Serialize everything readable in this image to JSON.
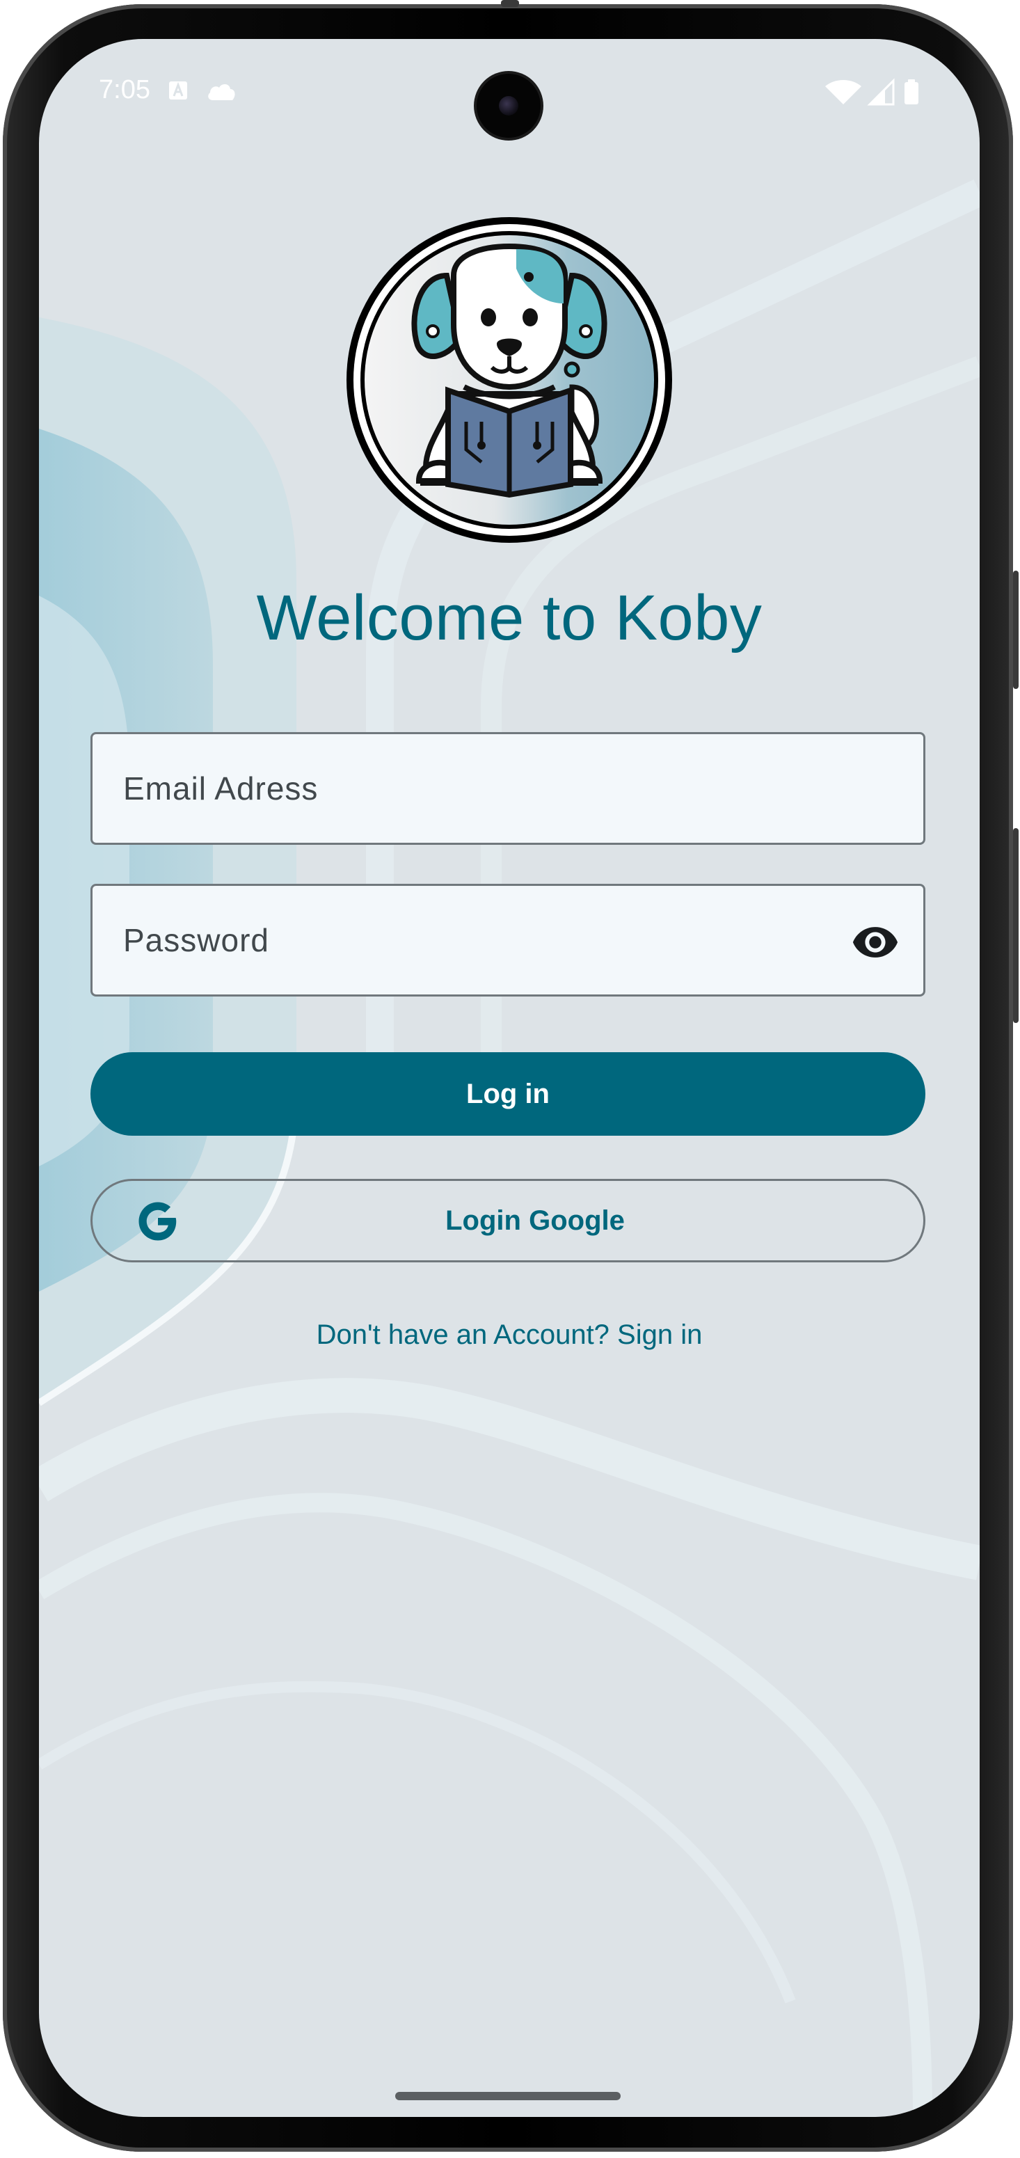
{
  "status_bar": {
    "time": "7:05",
    "left_icons": [
      "a-icon",
      "cloud-icon"
    ],
    "right_icons": [
      "wifi-icon",
      "signal-icon",
      "battery-icon"
    ]
  },
  "logo": {
    "icon": "dog-reading-book-logo"
  },
  "title": "Welcome to Koby",
  "form": {
    "email": {
      "placeholder": "Email Adress",
      "value": ""
    },
    "password": {
      "placeholder": "Password",
      "value": "",
      "visibility_icon": "eye-icon"
    },
    "login_label": "Log in",
    "google_label": "Login Google",
    "google_icon": "google-icon",
    "signup_text": "Don't have an Account? Sign in"
  },
  "colors": {
    "primary": "#00677d",
    "background": "#dde3e7",
    "field_background": "#f3f8fb",
    "outline": "#70787d"
  }
}
